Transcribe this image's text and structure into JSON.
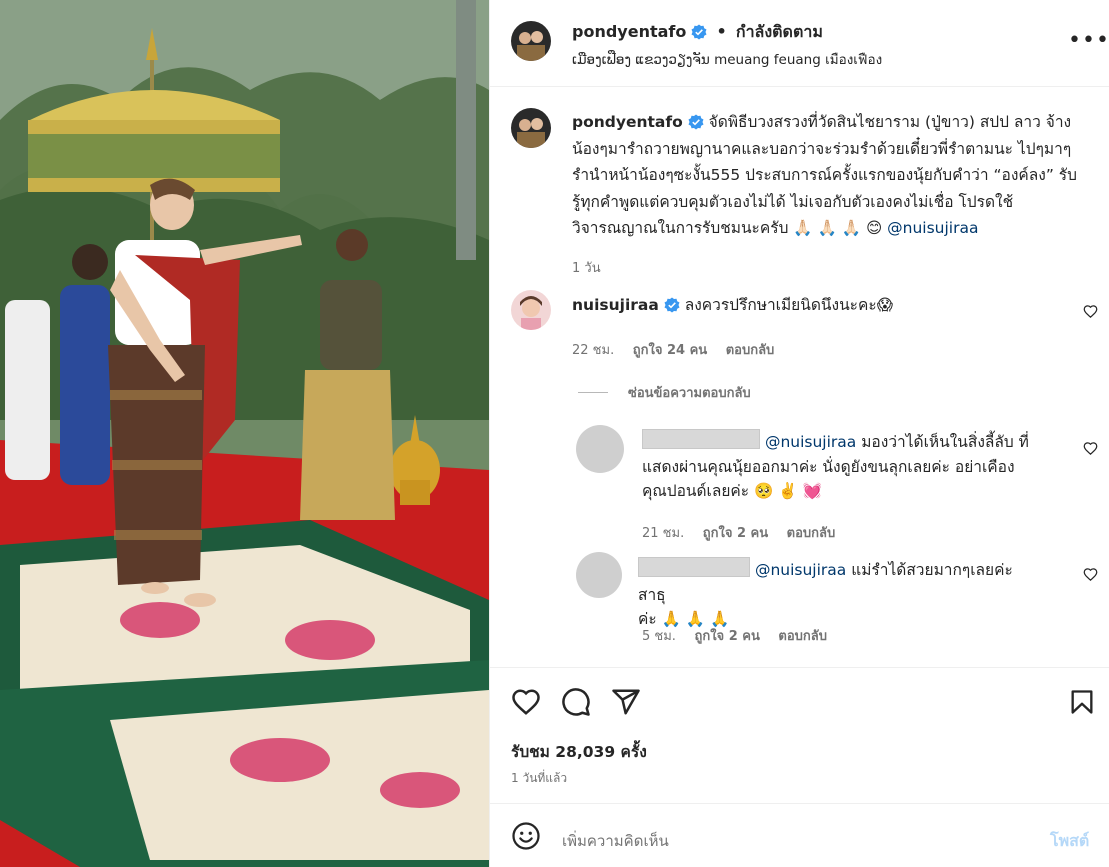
{
  "header": {
    "username": "pondyentafo",
    "separator": "•",
    "follow_status": "กำลังติดตาม",
    "location": "ເມືອງເຟືອງ ແຂວງວຽງຈັນ meuang feuang เมืองเฟือง",
    "more_icon": "more-horizontal-icon"
  },
  "caption": {
    "username": "pondyentafo",
    "text": "จัดพิธีบวงสรวงที่วัดสินไชยาราม (ปู่ขาว) สปป ลาว จ้างน้องๆมารำถวายพญานาคและบอกว่าจะร่วมรำด้วยเดี๋ยวพี่รำตามนะ ไปๆมาๆรำนำหน้าน้องๆซะงั้น555 ประสบการณ์ครั้งแรกของนุ้ยกับคำว่า “องค์ลง” รับรู้ทุกคำพูดแต่ควบคุมตัวเองไม่ได้ ไม่เจอกับตัวเองคงไม่เชื่อ โปรดใช้วิจารณญาณในการรับชมนะครับ",
    "emojis": "🙏🏻 🙏🏻 🙏🏻 😊",
    "mention": "@nuisujiraa",
    "time": "1 วัน"
  },
  "comments": [
    {
      "username": "nuisujiraa",
      "text": "ลงควรปรึกษาเมียนิดนึงนะคะ😱",
      "time": "22 ชม.",
      "likes": "ถูกใจ 24 คน",
      "reply": "ตอบกลับ"
    }
  ],
  "hide_replies": "ซ่อนข้อความตอบกลับ",
  "replies": [
    {
      "mention": "@nuisujiraa",
      "text_line1": "มองว่าได้เห็นในสิ่งลี้ลับ ที่",
      "text_line2": "แสดงผ่านคุณนุ้ยออกมาค่ะ นั่งดูยังขนลุกเลยค่ะ อย่าเคือง",
      "text_line3": "คุณปอนด์เลยค่ะ 🥺 ✌️ 💓",
      "time": "21 ชม.",
      "likes": "ถูกใจ 2 คน",
      "reply": "ตอบกลับ"
    },
    {
      "mention": "@nuisujiraa",
      "text_line1": "แม่รำได้สวยมากๆเลยค่ะ สาธุ",
      "text_line2": "ค่ะ 🙏 🙏 🙏",
      "time": "5 ชม.",
      "likes": "ถูกใจ 2 คน",
      "reply": "ตอบกลับ"
    }
  ],
  "actions": {
    "icons": [
      "heart-icon",
      "comment-icon",
      "share-icon",
      "bookmark-icon"
    ],
    "views": "รับชม 28,039 ครั้ง",
    "posted": "1 วันที่แล้ว"
  },
  "compose": {
    "emoji_icon": "smiley-icon",
    "placeholder": "เพิ่มความคิดเห็น",
    "post_label": "โพสต์"
  },
  "colors": {
    "verified": "#3897f0",
    "mention": "#00376b",
    "muted": "#737373",
    "post_disabled": "#b5d8f8"
  }
}
